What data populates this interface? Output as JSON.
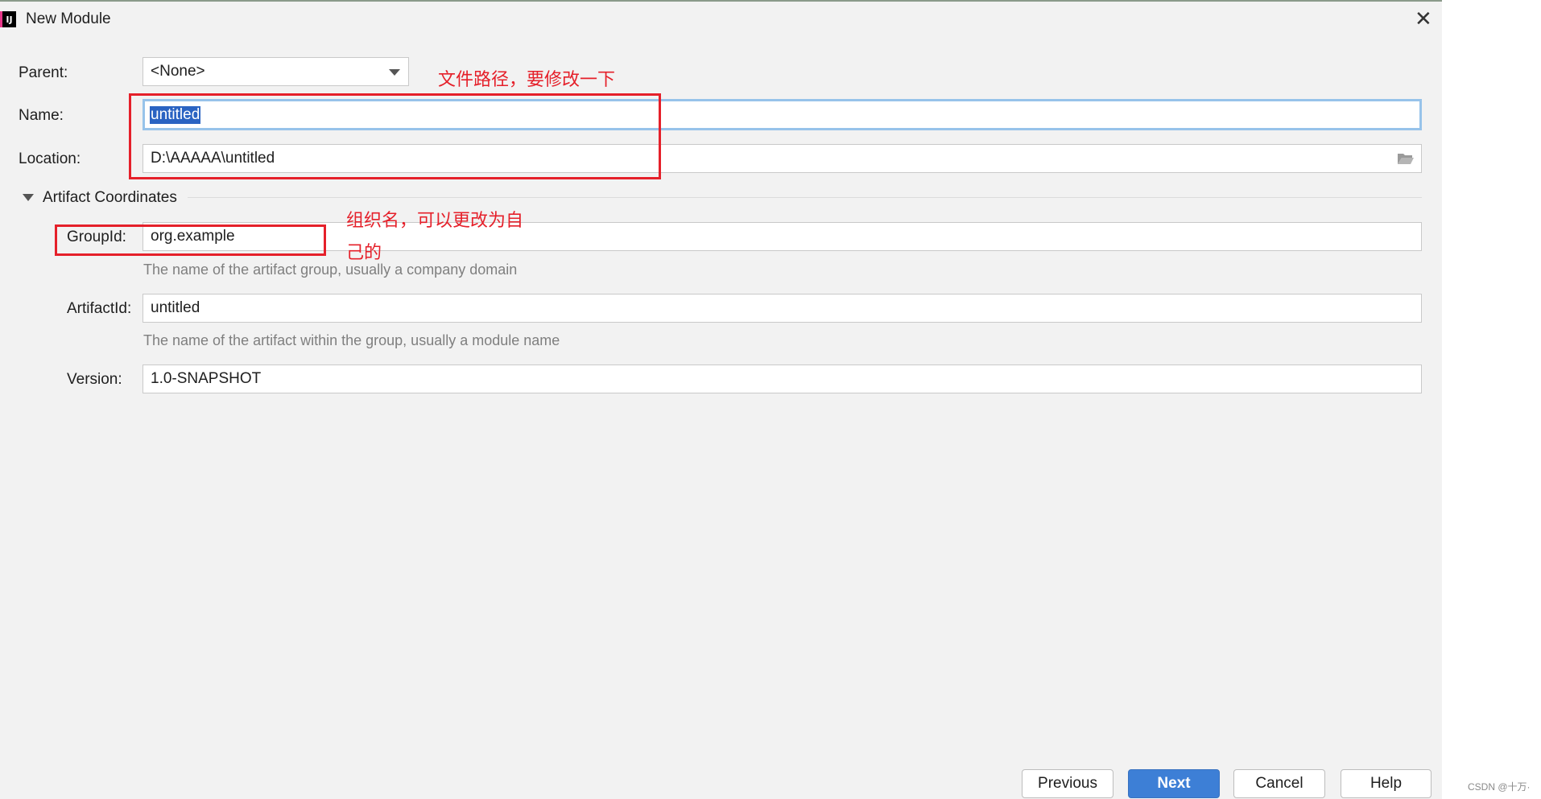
{
  "window": {
    "title": "New Module",
    "close_glyph": "✕",
    "icon_text": "IJ"
  },
  "form": {
    "parent": {
      "label": "Parent:",
      "value": "<None>"
    },
    "name": {
      "label": "Name:",
      "value": "untitled"
    },
    "location": {
      "label": "Location:",
      "value": "D:\\AAAAA\\untitled"
    }
  },
  "artifact": {
    "section_title": "Artifact Coordinates",
    "group_id": {
      "label": "GroupId:",
      "value": "org.example",
      "hint": "The name of the artifact group, usually a company domain"
    },
    "artifact_id": {
      "label": "ArtifactId:",
      "value": "untitled",
      "hint": "The name of the artifact within the group, usually a module name"
    },
    "version": {
      "label": "Version:",
      "value": "1.0-SNAPSHOT"
    }
  },
  "annotations": {
    "path_note": "文件路径，要修改一下",
    "group_note_line1": "组织名，可以更改为自",
    "group_note_line2": "己的"
  },
  "buttons": {
    "previous": "Previous",
    "next": "Next",
    "cancel": "Cancel",
    "help": "Help"
  },
  "watermark": "CSDN @十万·",
  "colors": {
    "accent": "#3d7fd6",
    "annotation": "#e5202a",
    "focus": "#97c3ea",
    "selection": "#2a63c2"
  }
}
